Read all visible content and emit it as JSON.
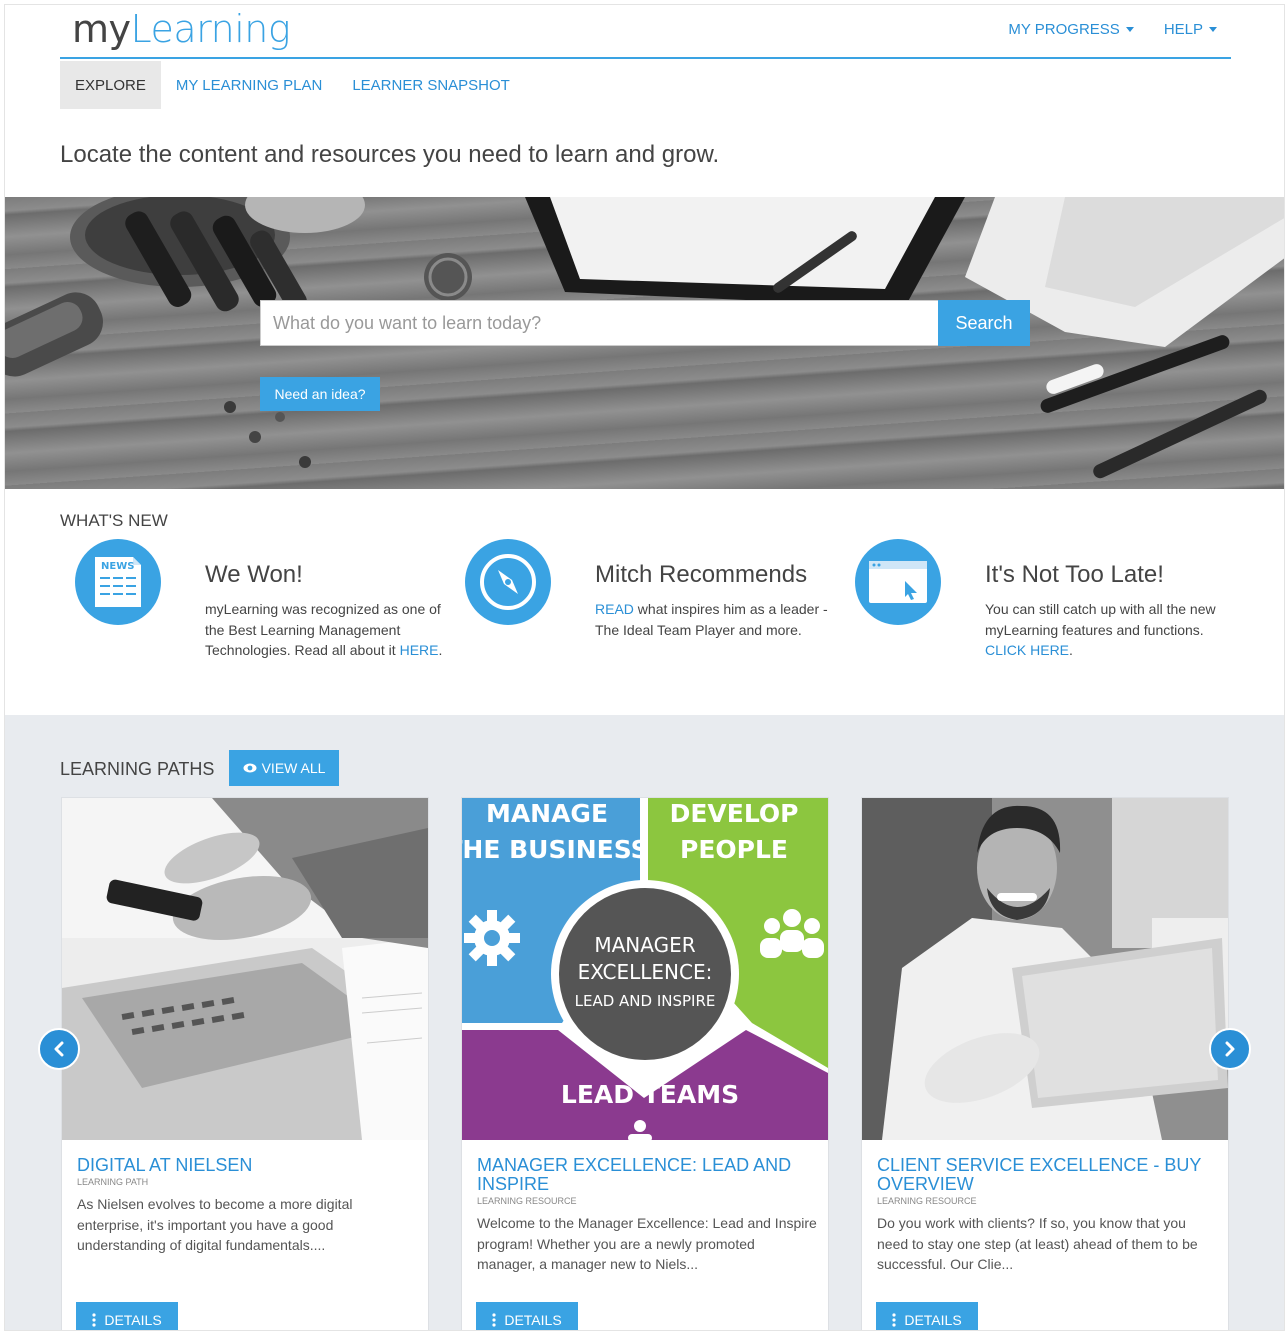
{
  "header": {
    "logo_my": "my",
    "logo_learning": "Learning",
    "nav": [
      {
        "label": "MY PROGRESS"
      },
      {
        "label": "HELP"
      }
    ]
  },
  "tabs": [
    {
      "label": "EXPLORE",
      "active": true
    },
    {
      "label": "MY LEARNING PLAN",
      "active": false
    },
    {
      "label": "LEARNER SNAPSHOT",
      "active": false
    }
  ],
  "tagline": "Locate the content and resources you need to learn and grow.",
  "hero": {
    "search_placeholder": "What do you want to learn today?",
    "search_button": "Search",
    "idea_button": "Need an idea?"
  },
  "whats_new": {
    "title": "WHAT'S NEW",
    "items": [
      {
        "icon": "news-icon",
        "icon_text": "NEWS",
        "title": "We Won!",
        "body": "myLearning was recognized as one of the Best Learning Management Technologies. Read all about it",
        "link": "HERE",
        "suffix": "."
      },
      {
        "icon": "compass-icon",
        "title": "Mitch Recommends",
        "link": "READ",
        "body": " what inspires him as a leader - The Ideal Team Player and more."
      },
      {
        "icon": "browser-cursor-icon",
        "title": "It's Not Too Late!",
        "body": "You can still catch up with all the new myLearning features and functions.",
        "link": "CLICK HERE",
        "suffix": "."
      }
    ]
  },
  "learning_paths": {
    "title": "LEARNING PATHS",
    "view_all": "VIEW ALL",
    "cards": [
      {
        "title": "DIGITAL AT NIELSEN",
        "type": "LEARNING PATH",
        "desc": "As Nielsen evolves to become a more digital enterprise, it's important you have a good understanding of digital fundamentals....",
        "details": "DETAILS"
      },
      {
        "title": "MANAGER EXCELLENCE: LEAD AND INSPIRE",
        "type": "LEARNING RESOURCE",
        "desc": "Welcome to the Manager Excellence: Lead and Inspire program! Whether you are a newly promoted manager, a manager new to Niels...",
        "details": "DETAILS",
        "graphic": {
          "manage_1": "MANAGE",
          "manage_2": "THE BUSINESS",
          "develop_1": "DEVELOP",
          "develop_2": "PEOPLE",
          "center_1": "MANAGER",
          "center_2": "EXCELLENCE:",
          "center_3": "LEAD AND INSPIRE",
          "lead": "LEAD TEAMS",
          "colors": {
            "blue": "#4a9fd8",
            "green": "#8cc63f",
            "purple": "#8b3a8f",
            "center": "#555555"
          }
        }
      },
      {
        "title": "CLIENT SERVICE EXCELLENCE - BUY OVERVIEW",
        "type": "LEARNING RESOURCE",
        "desc": "Do you work with clients? If so, you know that you need to stay one step (at least) ahead of them to be successful. Our Clie...",
        "details": "DETAILS"
      }
    ]
  },
  "colors": {
    "accent": "#3aa3e3",
    "link": "#2a8fd6",
    "paths_bg": "#e8ebef"
  }
}
